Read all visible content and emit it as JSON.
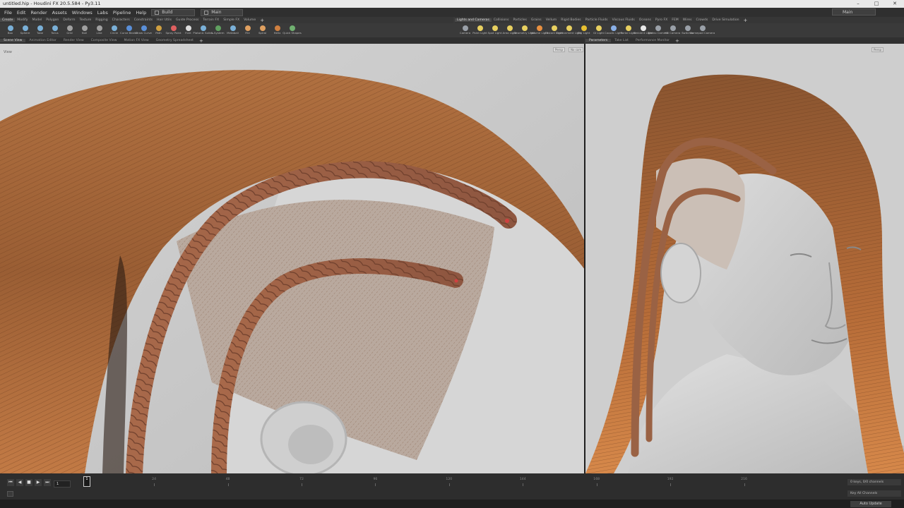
{
  "title_bar": {
    "title": "untitled.hip - Houdini FX 20.5.584 - Py3.11"
  },
  "menu": [
    "File",
    "Edit",
    "Render",
    "Assets",
    "Windows",
    "Labs",
    "Pipeline",
    "Help"
  ],
  "desktop": {
    "build_label": "Build",
    "network_label": "Main",
    "right_desktop_label": "Main"
  },
  "shelf_tabs_left": [
    "Create",
    "Modify",
    "Model",
    "Polygon",
    "Deform",
    "Texture",
    "Rigging",
    "Characters",
    "Constraints",
    "Hair Utils",
    "Guide Process",
    "Terrain FX",
    "Simple FX",
    "Volume"
  ],
  "shelf_tabs_right": [
    "Lights and Cameras",
    "Collisions",
    "Particles",
    "Grains",
    "Vellum",
    "Rigid Bodies",
    "Particle Fluids",
    "Viscous Fluids",
    "Oceans",
    "Pyro FX",
    "FEM",
    "Wires",
    "Crowds",
    "Drive Simulation"
  ],
  "tools_left": [
    {
      "label": "Box",
      "color": "#7ab0d8"
    },
    {
      "label": "Sphere",
      "color": "#7ab0d8"
    },
    {
      "label": "Tube",
      "color": "#7ab0d8"
    },
    {
      "label": "Torus",
      "color": "#7ab0d8"
    },
    {
      "label": "Grid",
      "color": "#a0a0a0"
    },
    {
      "label": "Null",
      "color": "#a0a0a0"
    },
    {
      "label": "Line",
      "color": "#a0a0a0"
    },
    {
      "label": "Circle",
      "color": "#7ab0d8"
    },
    {
      "label": "Curve Bezier",
      "color": "#5a8fd8"
    },
    {
      "label": "Draw Curve",
      "color": "#5a8fd8"
    },
    {
      "label": "Path",
      "color": "#d0a040"
    },
    {
      "label": "Spray Paint",
      "color": "#e06060"
    },
    {
      "label": "Font",
      "color": "#dddddd"
    },
    {
      "label": "Platonic Solids",
      "color": "#7ab0d8"
    },
    {
      "label": "L-System",
      "color": "#60a060"
    },
    {
      "label": "Metaball",
      "color": "#7ab0d8"
    },
    {
      "label": "File",
      "color": "#e0a060"
    },
    {
      "label": "Spiral",
      "color": "#e0a060"
    },
    {
      "label": "Helix",
      "color": "#d08040"
    },
    {
      "label": "Quick Shapes",
      "color": "#70b070"
    }
  ],
  "tools_right": [
    {
      "label": "Camera",
      "color": "#9aa0a8"
    },
    {
      "label": "Point Light",
      "color": "#e8d060"
    },
    {
      "label": "Spot Light",
      "color": "#e8d060"
    },
    {
      "label": "Area Light",
      "color": "#e8d060"
    },
    {
      "label": "Geometry Light",
      "color": "#e8d060"
    },
    {
      "label": "Volume Light",
      "color": "#e89040"
    },
    {
      "label": "Distant Light",
      "color": "#e8d060"
    },
    {
      "label": "Environment Light",
      "color": "#e8d060"
    },
    {
      "label": "Sky Light",
      "color": "#e8c030"
    },
    {
      "label": "GI Light",
      "color": "#e8d060"
    },
    {
      "label": "Caustic Light",
      "color": "#8ab0e8"
    },
    {
      "label": "Portal Light",
      "color": "#e8d060"
    },
    {
      "label": "Ambient Light",
      "color": "#e8e8e8"
    },
    {
      "label": "Stereo Camera",
      "color": "#9aa0a8"
    },
    {
      "label": "VR Camera",
      "color": "#9aa0a8"
    },
    {
      "label": "Switcher",
      "color": "#9aa0a8"
    },
    {
      "label": "Gamepad Camera",
      "color": "#9aa0a8"
    }
  ],
  "pane_tabs_left": [
    "Scene View",
    "Animation Editor",
    "Render View",
    "Composite View",
    "Motion FX View",
    "Geometry Spreadsheet"
  ],
  "pane_tabs_right": [
    "Parameters",
    "Take List",
    "Performance Monitor"
  ],
  "viewport": {
    "persp_label": "Persp",
    "cam_label": "No cam",
    "view_label": "View"
  },
  "timeline": {
    "current_frame": "1",
    "tick_labels": [
      "24",
      "48",
      "72",
      "96",
      "120",
      "144",
      "168",
      "192",
      "216"
    ],
    "start_frame": "1",
    "range_start": "1",
    "range_end": "240",
    "end_frame": "240",
    "keys_info": "0 keys, 0/0 channels",
    "key_all_channels": "Key All Channels",
    "auto_update": "Auto Update"
  }
}
